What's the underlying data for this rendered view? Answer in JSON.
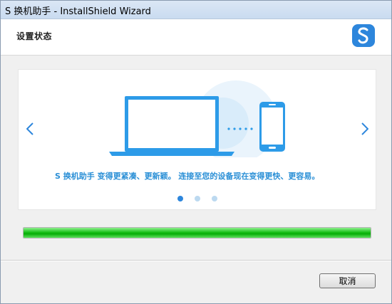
{
  "window": {
    "title": "S 换机助手 - InstallShield Wizard"
  },
  "header": {
    "title": "设置状态",
    "logo_icon": "app-logo-icon",
    "logo_letter": "S"
  },
  "carousel": {
    "caption": "S 换机助手 变得更紧凑、更新颖。 连接至您的设备现在变得更快、更容易。",
    "prev_icon": "chevron-left-icon",
    "next_icon": "chevron-right-icon",
    "illustration_icons": [
      "laptop-icon",
      "phone-icon"
    ],
    "page_count": 3,
    "active_page": 1
  },
  "progress": {
    "fraction": 1.0
  },
  "footer": {
    "cancel_label": "取消"
  },
  "colors": {
    "accent": "#2d86dc",
    "caption": "#2a8fd6",
    "progress": "#18c018"
  }
}
